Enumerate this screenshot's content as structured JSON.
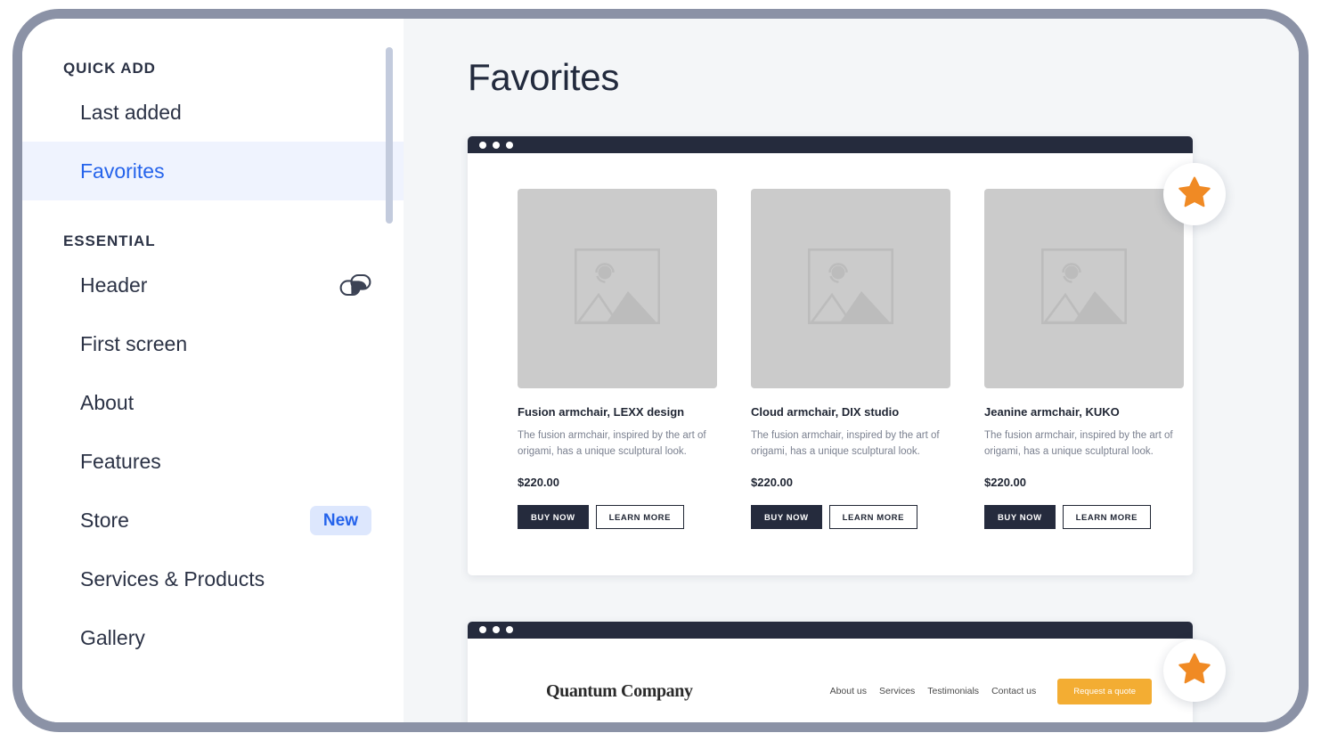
{
  "sidebar": {
    "sections": [
      {
        "title": "QUICK ADD",
        "items": [
          {
            "label": "Last added",
            "active": false,
            "icon": null,
            "badge": null
          },
          {
            "label": "Favorites",
            "active": true,
            "icon": null,
            "badge": null
          }
        ]
      },
      {
        "title": "ESSENTIAL",
        "items": [
          {
            "label": "Header",
            "active": false,
            "icon": "link-icon",
            "badge": null
          },
          {
            "label": "First screen",
            "active": false,
            "icon": null,
            "badge": null
          },
          {
            "label": "About",
            "active": false,
            "icon": null,
            "badge": null
          },
          {
            "label": "Features",
            "active": false,
            "icon": null,
            "badge": null
          },
          {
            "label": "Store",
            "active": false,
            "icon": null,
            "badge": "New"
          },
          {
            "label": "Services & Products",
            "active": false,
            "icon": null,
            "badge": null
          },
          {
            "label": "Gallery",
            "active": false,
            "icon": null,
            "badge": null
          }
        ]
      }
    ]
  },
  "main": {
    "page_title": "Favorites",
    "products_card": {
      "star_badge_icon": "star-icon",
      "products": [
        {
          "thumb_icon": "image-placeholder-icon",
          "name": "Fusion armchair, LEXX design",
          "description": "The fusion armchair, inspired by the art of origami, has a unique sculptural look.",
          "price": "$220.00",
          "buy_label": "BUY NOW",
          "learn_label": "LEARN MORE"
        },
        {
          "thumb_icon": "image-placeholder-icon",
          "name": "Cloud armchair, DIX studio",
          "description": "The fusion armchair, inspired by the art of origami, has a unique sculptural look.",
          "price": "$220.00",
          "buy_label": "BUY NOW",
          "learn_label": "LEARN MORE"
        },
        {
          "thumb_icon": "image-placeholder-icon",
          "name": "Jeanine armchair, KUKO",
          "description": "The fusion armchair, inspired by the art of origami, has a unique sculptural look.",
          "price": "$220.00",
          "buy_label": "BUY NOW",
          "learn_label": "LEARN MORE"
        }
      ]
    },
    "header_card": {
      "star_badge_icon": "star-icon",
      "brand": "Quantum Company",
      "nav": [
        "About us",
        "Services",
        "Testimonials",
        "Contact us"
      ],
      "cta_label": "Request a quote"
    }
  },
  "colors": {
    "accent_blue": "#2563eb",
    "active_bg": "#eff3fe",
    "star_orange": "#f08a24",
    "cta_yellow": "#f3ad33",
    "dark": "#252b3d",
    "frame": "#8b92a6",
    "canvas": "#f4f6f8"
  }
}
